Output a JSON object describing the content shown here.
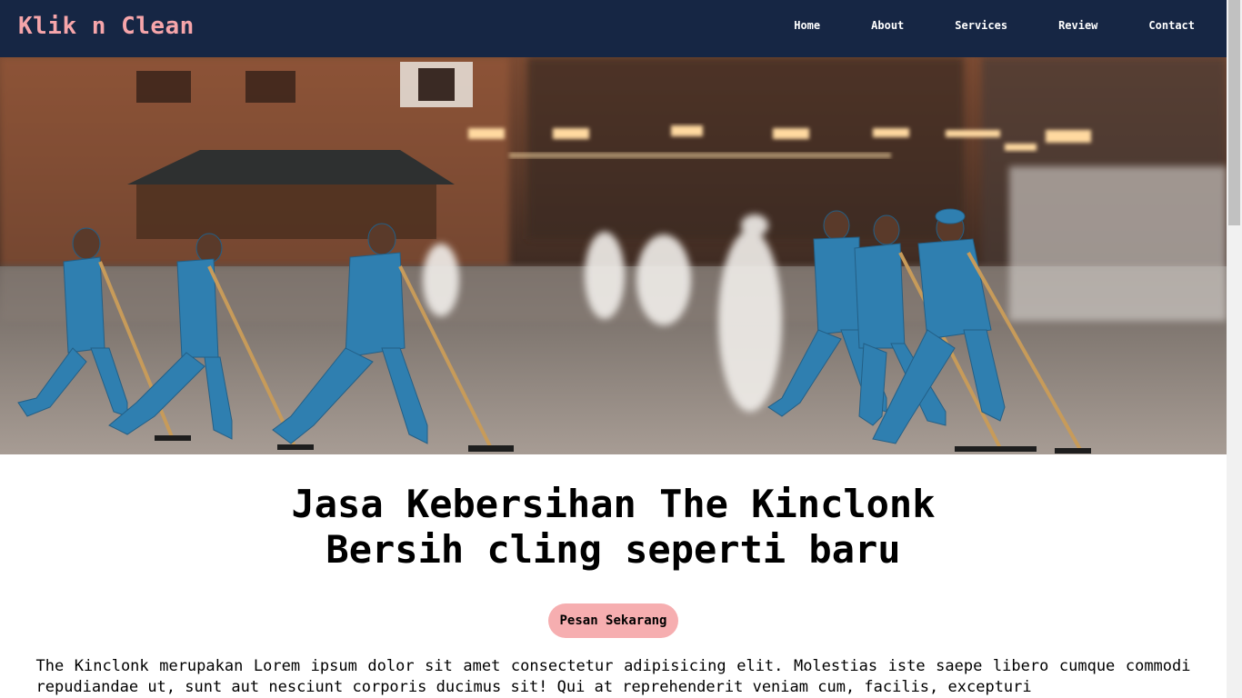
{
  "navbar": {
    "brand": "Klik n Clean",
    "links": [
      {
        "label": "Home"
      },
      {
        "label": "About"
      },
      {
        "label": "Services"
      },
      {
        "label": "Review"
      },
      {
        "label": "Contact"
      }
    ]
  },
  "hero": {
    "image_subject": "street-cleaners-running-with-brooms"
  },
  "main": {
    "headline_line1": "Jasa Kebersihan The Kinclonk",
    "headline_line2": "Bersih cling seperti baru",
    "cta_label": "Pesan Sekarang",
    "description": "The Kinclonk merupakan Lorem ipsum dolor sit amet consectetur adipisicing elit. Molestias iste saepe libero cumque commodi repudiandae ut, sunt aut nesciunt corporis ducimus sit! Qui at reprehenderit veniam cum, facilis, excepturi"
  },
  "colors": {
    "navbar_bg": "#162644",
    "brand": "#f6a5aa",
    "cta_bg": "#f6aeb0",
    "uniform": "#2f7fb0"
  }
}
